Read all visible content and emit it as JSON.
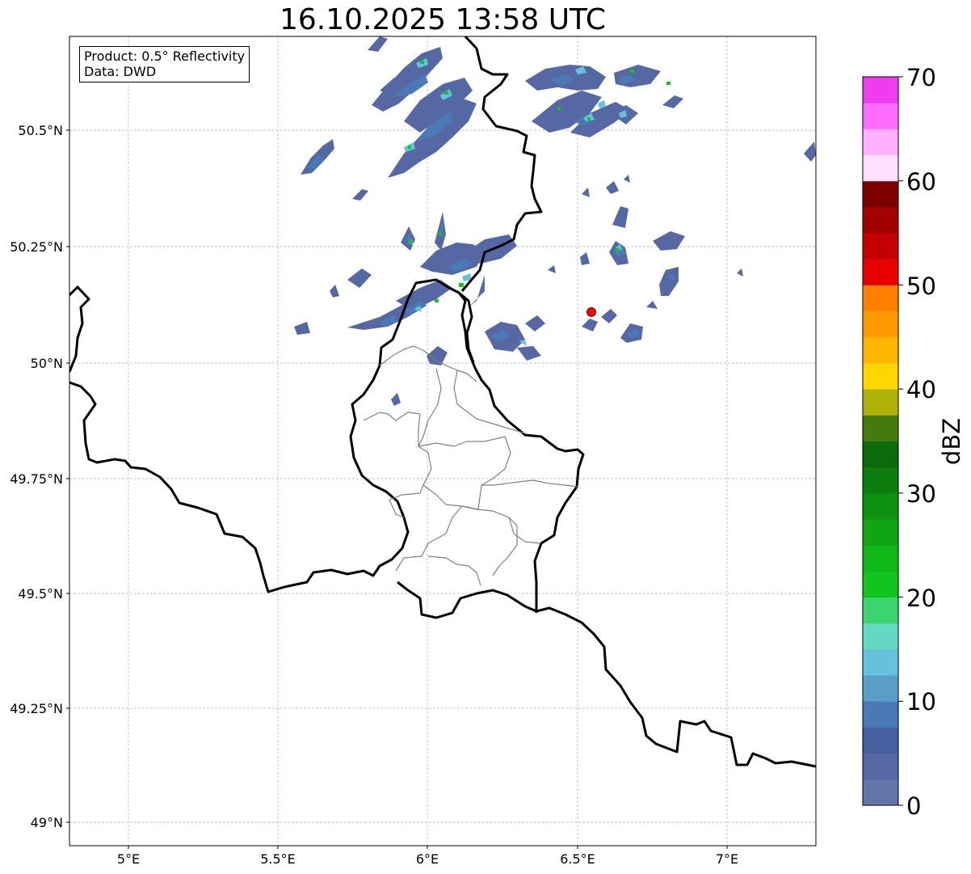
{
  "title": "16.10.2025 13:58 UTC",
  "info": {
    "product": "Product: 0.5° Reflectivity",
    "source": "Data: DWD"
  },
  "axes": {
    "lon_ticks": [
      "5°E",
      "5.5°E",
      "6°E",
      "6.5°E",
      "7°E"
    ],
    "lat_ticks": [
      "50.5°N",
      "50.25°N",
      "50°N",
      "49.75°N",
      "49.5°N",
      "49.25°N",
      "49°N"
    ]
  },
  "colorbar": {
    "label": "dBZ",
    "ticks": [
      "0",
      "10",
      "20",
      "30",
      "40",
      "50",
      "60",
      "70"
    ],
    "colors": [
      "#6574a8",
      "#5668a3",
      "#4760a0",
      "#4a7ab5",
      "#5a9ec8",
      "#66c2dc",
      "#64d8c2",
      "#3cd46e",
      "#12c41e",
      "#10b818",
      "#0fa514",
      "#0e9010",
      "#0d7c0f",
      "#0a6a0c",
      "#457a0e",
      "#adb10a",
      "#ffd600",
      "#ffb600",
      "#ff9900",
      "#ff7f00",
      "#e60000",
      "#c50000",
      "#a30000",
      "#7d0000",
      "#ffe0ff",
      "#ffb0ff",
      "#ff6bff",
      "#ee3cee"
    ]
  },
  "marker": {
    "name": "radar site",
    "color": "#ff0000"
  },
  "colors": {
    "border": "#000000",
    "cantons": "#808080",
    "grid": "#b0b0b0"
  }
}
